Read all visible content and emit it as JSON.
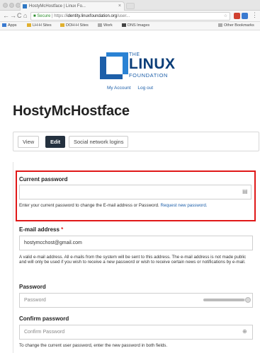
{
  "browser": {
    "tab_title": "HostyMcHostface | Linux Fo...",
    "tab_close": "×",
    "nav": {
      "back": "←",
      "forward": "→",
      "reload": "C",
      "home": "⌂"
    },
    "address": {
      "secure_label": "Secure",
      "url_prefix": "https://",
      "url_host": "identity.linuxfoundation.org",
      "url_rest": "/user..."
    },
    "bookmarks": [
      {
        "label": "Apps"
      },
      {
        "label": "LH-H Sites"
      },
      {
        "label": "DOH-H Sites"
      },
      {
        "label": "Work"
      },
      {
        "label": "DNS Images"
      },
      {
        "label": "Other Bookmarks"
      }
    ],
    "colors": {
      "ext1": "#d04030",
      "ext2": "#3a7ad0",
      "ext3": "#e0b030"
    }
  },
  "logo": {
    "the": "THE",
    "linux": "LINUX",
    "foundation": "FOUNDATION"
  },
  "user_links": {
    "my_account": "My Account",
    "logout": "Log out"
  },
  "page": {
    "title": "HostyMcHostface"
  },
  "tabs": [
    {
      "label": "View",
      "active": false
    },
    {
      "label": "Edit",
      "active": true
    },
    {
      "label": "Social network logins",
      "active": false
    }
  ],
  "form": {
    "current_password": {
      "label": "Current password",
      "value": "",
      "help_text": "Enter your current password to change the E-mail address or Password.",
      "help_link": "Request new password."
    },
    "email": {
      "label": "E-mail address",
      "required_marker": "*",
      "value": "hostymcchost@gmail.com",
      "help_text": "A valid e-mail address. All e-mails from the system will be sent to this address. The e-mail address is not made public and will only be used if you wish to receive a new password or wish to receive certain news or notifications by e-mail."
    },
    "password": {
      "label": "Password",
      "placeholder": "Password",
      "strength_fraction": 0.9
    },
    "confirm_password": {
      "label": "Confirm password",
      "placeholder": "Confirm Password",
      "help_text": "To change the current user password, enter the new password in both fields."
    }
  },
  "icons": {
    "key": "key-icon",
    "check": "check-circle-icon"
  }
}
